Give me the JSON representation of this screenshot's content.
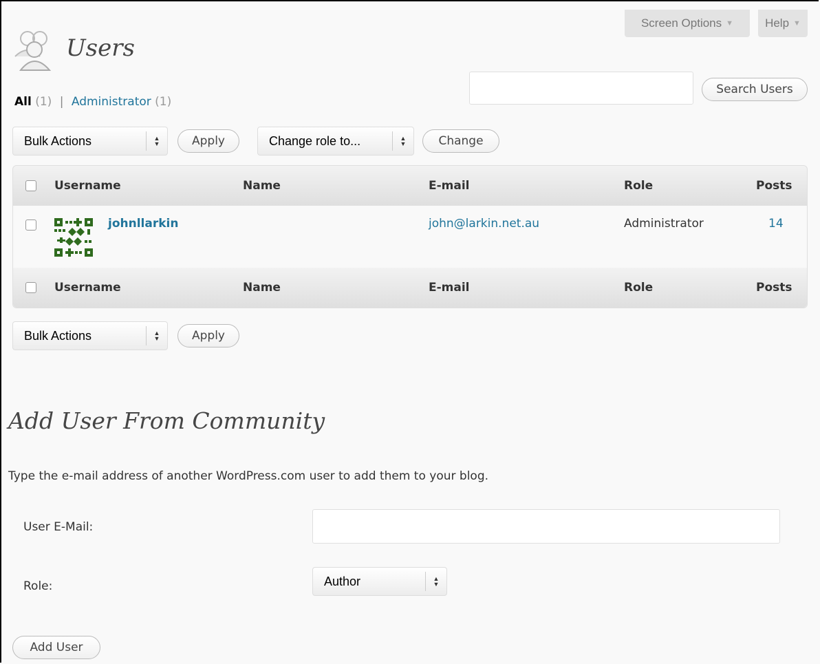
{
  "tabs": {
    "screen_options": "Screen Options",
    "help": "Help"
  },
  "header": {
    "title": "Users",
    "icon": "users-icon"
  },
  "filters": {
    "all_label": "All",
    "all_count": "(1)",
    "separator": "|",
    "admin_label": "Administrator",
    "admin_count": "(1)"
  },
  "search": {
    "value": "",
    "button_label": "Search Users"
  },
  "toolbar": {
    "bulk_actions": "Bulk Actions",
    "apply": "Apply",
    "change_role": "Change role to...",
    "change": "Change"
  },
  "table": {
    "columns": [
      "Username",
      "Name",
      "E-mail",
      "Role",
      "Posts"
    ],
    "rows": [
      {
        "username": "johnllarkin",
        "name": "",
        "email": "john@larkin.net.au",
        "role": "Administrator",
        "posts": "14"
      }
    ]
  },
  "add_user": {
    "title": "Add User From Community",
    "description": "Type the e-mail address of another WordPress.com user to add them to your blog.",
    "email_label": "User E-Mail:",
    "email_value": "",
    "role_label": "Role:",
    "role_value": "Author",
    "button_label": "Add User"
  },
  "colors": {
    "link": "#21759b",
    "avatar": "#2f6b1e",
    "heading": "#464646"
  }
}
